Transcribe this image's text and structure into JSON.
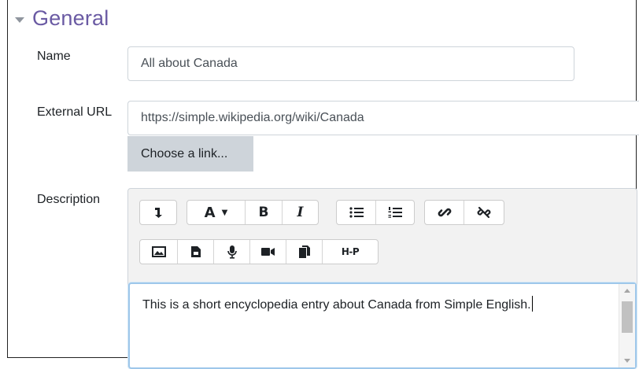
{
  "section": {
    "title": "General"
  },
  "fields": {
    "name": {
      "label": "Name",
      "value": "All about Canada"
    },
    "external_url": {
      "label": "External URL",
      "value": "https://simple.wikipedia.org/wiki/Canada",
      "choose_button": "Choose a link..."
    },
    "description": {
      "label": "Description",
      "value": "This is a short encyclopedia entry about Canada from Simple English."
    }
  },
  "toolbar": {
    "row1": [
      {
        "name": "show-more-buttons",
        "icon": "arrow-down-icon"
      },
      {
        "name": "font-color",
        "icon": "font-a-icon",
        "label": "A ▾"
      },
      {
        "name": "bold",
        "icon": "bold-icon",
        "label": "B"
      },
      {
        "name": "italic",
        "icon": "italic-icon",
        "label": "I"
      },
      {
        "name": "unordered-list",
        "icon": "bullet-list-icon"
      },
      {
        "name": "ordered-list",
        "icon": "numbered-list-icon"
      },
      {
        "name": "link",
        "icon": "link-icon"
      },
      {
        "name": "unlink",
        "icon": "unlink-icon"
      }
    ],
    "row2": [
      {
        "name": "image",
        "icon": "image-icon"
      },
      {
        "name": "media",
        "icon": "file-icon"
      },
      {
        "name": "record-audio",
        "icon": "microphone-icon"
      },
      {
        "name": "record-video",
        "icon": "video-camera-icon"
      },
      {
        "name": "manage-files",
        "icon": "copy-files-icon"
      },
      {
        "name": "h5p",
        "icon": "h5p-icon",
        "label": "H-P"
      }
    ]
  },
  "colors": {
    "section_title": "#6a5aa3",
    "choose_button_bg": "#ced4da",
    "editor_bg": "#f2f2f2",
    "focus_border": "#9ec7ea"
  }
}
